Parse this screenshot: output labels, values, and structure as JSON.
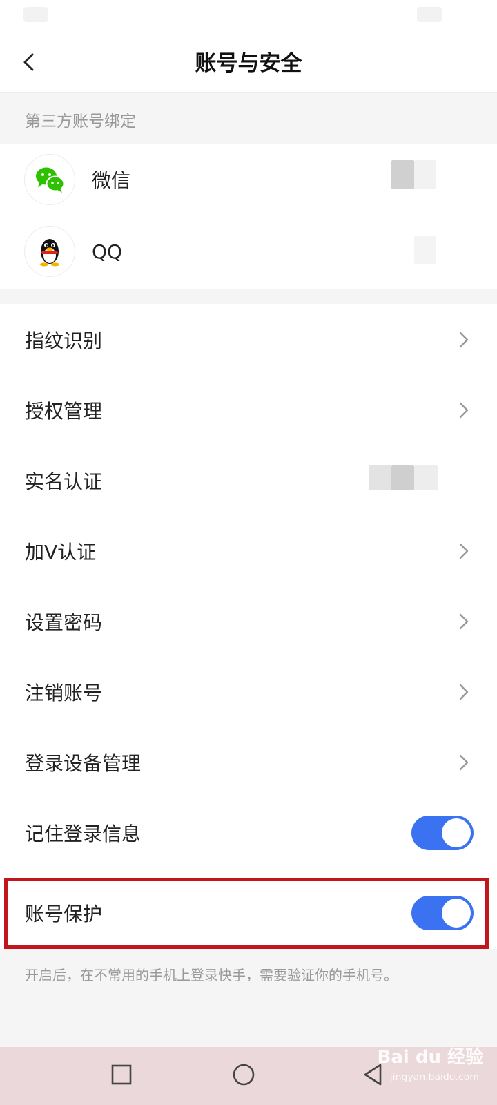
{
  "header": {
    "title": "账号与安全",
    "back_icon": "chevron-left-icon"
  },
  "third_party": {
    "section_label": "第三方账号绑定",
    "items": [
      {
        "label": "微信",
        "icon": "wechat-icon"
      },
      {
        "label": "QQ",
        "icon": "qq-penguin-icon"
      }
    ]
  },
  "menu": {
    "items": [
      {
        "label": "指纹识别",
        "control": "chevron"
      },
      {
        "label": "授权管理",
        "control": "chevron"
      },
      {
        "label": "实名认证",
        "control": "blurred-status"
      },
      {
        "label": "加V认证",
        "control": "chevron"
      },
      {
        "label": "设置密码",
        "control": "chevron"
      },
      {
        "label": "注销账号",
        "control": "chevron"
      },
      {
        "label": "登录设备管理",
        "control": "chevron"
      },
      {
        "label": "记住登录信息",
        "control": "toggle",
        "on": true
      },
      {
        "label": "账号保护",
        "control": "toggle",
        "on": true
      }
    ]
  },
  "footnote": "开启后，在不常用的手机上登录快手，需要验证你的手机号。",
  "navigation": {
    "buttons": [
      "recent-apps-icon",
      "home-icon",
      "back-icon"
    ]
  },
  "watermark": {
    "brand": "Bai du 经验",
    "url": "jingyan.baidu.com"
  },
  "colors": {
    "toggle_on": "#3a72f2",
    "highlight_border": "#c0161c",
    "wechat_green": "#2dc100",
    "nav_bar": "#ead8da"
  }
}
